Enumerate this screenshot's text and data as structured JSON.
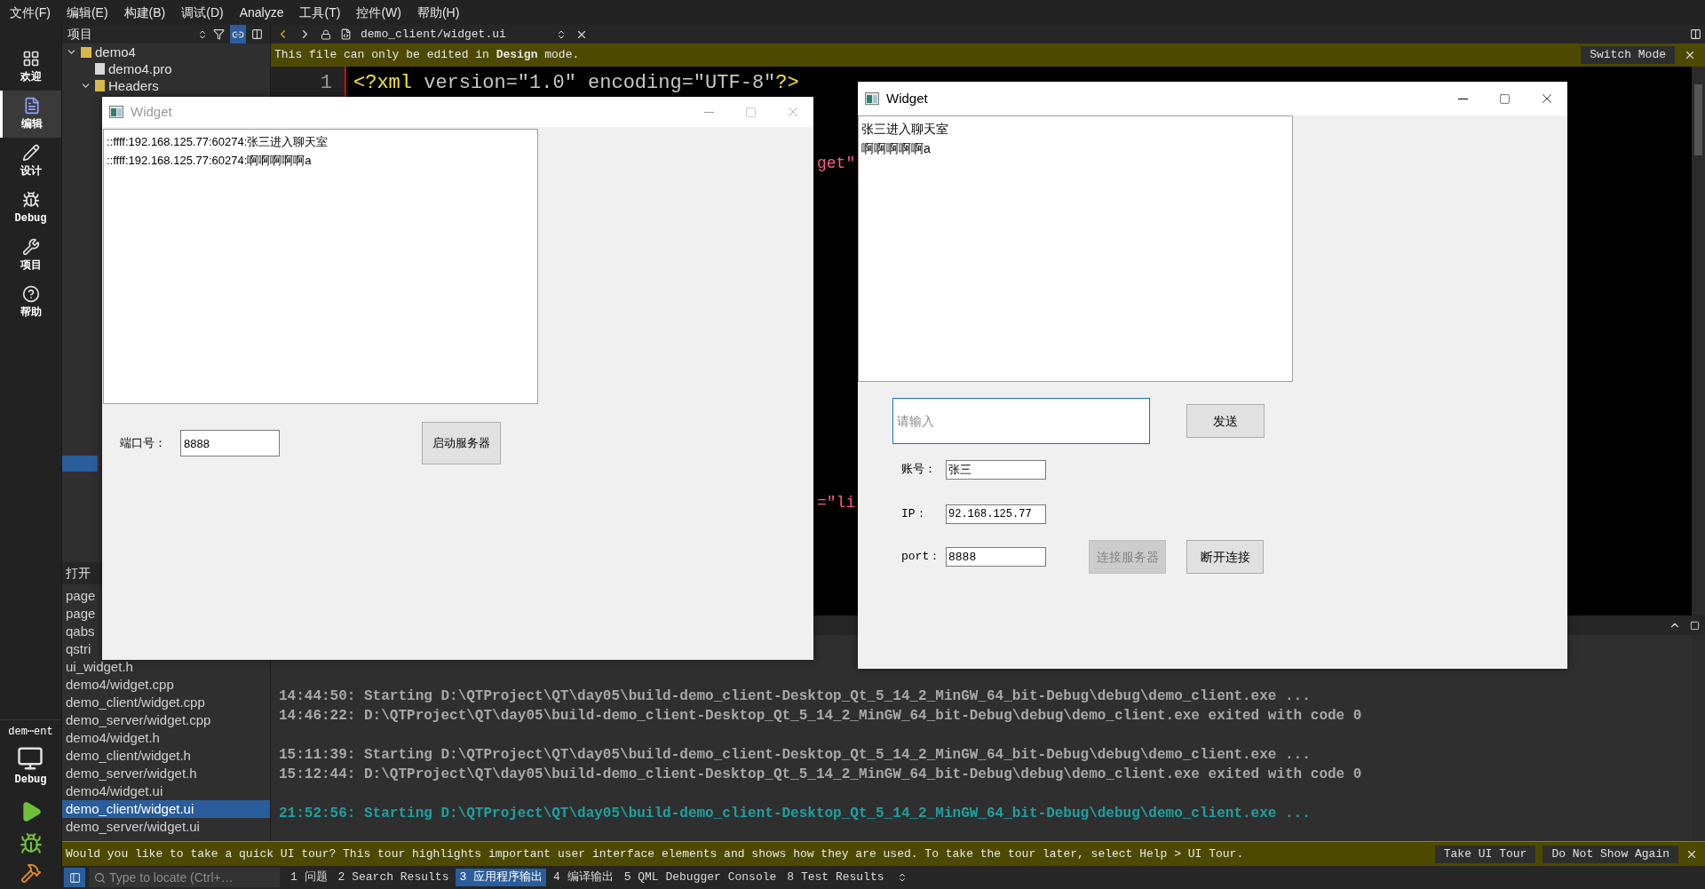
{
  "menu": [
    "文件(F)",
    "编辑(E)",
    "构建(B)",
    "调试(D)",
    "Analyze",
    "工具(T)",
    "控件(W)",
    "帮助(H)"
  ],
  "mode_bar": {
    "items": [
      {
        "label": "欢迎",
        "selected": false
      },
      {
        "label": "编辑",
        "selected": true
      },
      {
        "label": "设计",
        "selected": false
      },
      {
        "label": "Debug",
        "selected": false
      },
      {
        "label": "项目",
        "selected": false
      },
      {
        "label": "帮助",
        "selected": false
      }
    ],
    "kit": "dem⋯ent",
    "build": "Debug"
  },
  "project_pane": {
    "title": "项目",
    "tree": [
      {
        "label": "demo4",
        "expanded": true,
        "children": [
          {
            "label": "demo4.pro"
          },
          {
            "label": "Headers",
            "expanded": true
          }
        ]
      }
    ]
  },
  "open_documents": {
    "title": "打开",
    "items": [
      {
        "label": "page",
        "selected": false
      },
      {
        "label": "page",
        "selected": false
      },
      {
        "label": "qabs",
        "selected": false
      },
      {
        "label": "qstri",
        "selected": false
      },
      {
        "label": "ui_widget.h",
        "selected": false
      },
      {
        "label": "demo4/widget.cpp",
        "selected": false
      },
      {
        "label": "demo_client/widget.cpp",
        "selected": false
      },
      {
        "label": "demo_server/widget.cpp",
        "selected": false
      },
      {
        "label": "demo4/widget.h",
        "selected": false
      },
      {
        "label": "demo_client/widget.h",
        "selected": false
      },
      {
        "label": "demo_server/widget.h",
        "selected": false
      },
      {
        "label": "demo4/widget.ui",
        "selected": false
      },
      {
        "label": "demo_client/widget.ui",
        "selected": true
      },
      {
        "label": "demo_server/widget.ui",
        "selected": false
      }
    ]
  },
  "editor": {
    "file": "demo_client/widget.ui",
    "info_bar": {
      "message": "This file can only be edited in **Design** mode.",
      "button": "Switch Mode"
    },
    "line_number": "1",
    "code": [
      {
        "text": "<?xml",
        "kind": "tag"
      },
      {
        "text": " version=\"1.0\" encoding=\"UTF-8\"",
        "kind": "attr"
      },
      {
        "text": "?>",
        "kind": "tag"
      }
    ],
    "fragments": [
      {
        "text": "get\"",
        "kind": "string"
      },
      {
        "text": "=\"li",
        "kind": "string"
      }
    ]
  },
  "server_window": {
    "title": "Widget",
    "active": false,
    "log": [
      "::ffff:192.168.125.77:60274:张三进入聊天室",
      "::ffff:192.168.125.77:60274:啊啊啊啊啊a"
    ],
    "port_label": "端口号：",
    "port_value": "8888",
    "start_button": "启动服务器"
  },
  "client_window": {
    "title": "Widget",
    "active": true,
    "log": [
      "张三进入聊天室",
      "啊啊啊啊啊a"
    ],
    "message_placeholder": "请输入",
    "send_button": "发送",
    "account_label": "账号：",
    "account_value": "张三",
    "ip_label": "IP：",
    "ip_value": "92.168.125.77",
    "port_label": "port：",
    "port_value": "8888",
    "connect_button": {
      "label": "连接服务器",
      "disabled": true
    },
    "disconnect_button": {
      "label": "断开连接",
      "disabled": false
    }
  },
  "output": {
    "runs": [
      {
        "current": false,
        "lines": [
          "14:44:50: Starting D:\\QTProject\\QT\\day05\\build-demo_client-Desktop_Qt_5_14_2_MinGW_64_bit-Debug\\debug\\demo_client.exe ...",
          "14:46:22: D:\\QTProject\\QT\\day05\\build-demo_client-Desktop_Qt_5_14_2_MinGW_64_bit-Debug\\debug\\demo_client.exe exited with code 0"
        ]
      },
      {
        "current": false,
        "lines": [
          "15:11:39: Starting D:\\QTProject\\QT\\day05\\build-demo_client-Desktop_Qt_5_14_2_MinGW_64_bit-Debug\\debug\\demo_client.exe ...",
          "15:12:44: D:\\QTProject\\QT\\day05\\build-demo_client-Desktop_Qt_5_14_2_MinGW_64_bit-Debug\\debug\\demo_client.exe exited with code 0"
        ]
      },
      {
        "current": true,
        "lines": [
          "21:52:56: Starting D:\\QTProject\\QT\\day05\\build-demo_client-Desktop_Qt_5_14_2_MinGW_64_bit-Debug\\debug\\demo_client.exe ..."
        ]
      }
    ]
  },
  "tour_bar": {
    "message": "Would you like to take a quick UI tour? This tour highlights important user interface elements and shows how they are used. To take the tour later, select Help > UI Tour.",
    "buttons": [
      "Take UI Tour",
      "Do Not Show Again"
    ]
  },
  "status_bar": {
    "search_placeholder": "Type to locate (Ctrl+…",
    "tabs": [
      {
        "label": "1 问题",
        "selected": false
      },
      {
        "label": "2 Search Results",
        "selected": false
      },
      {
        "label": "3 应用程序输出",
        "selected": true
      },
      {
        "label": "4 编译输出",
        "selected": false
      },
      {
        "label": "5 QML Debugger Console",
        "selected": false
      },
      {
        "label": "8 Test Results",
        "selected": false
      }
    ]
  }
}
